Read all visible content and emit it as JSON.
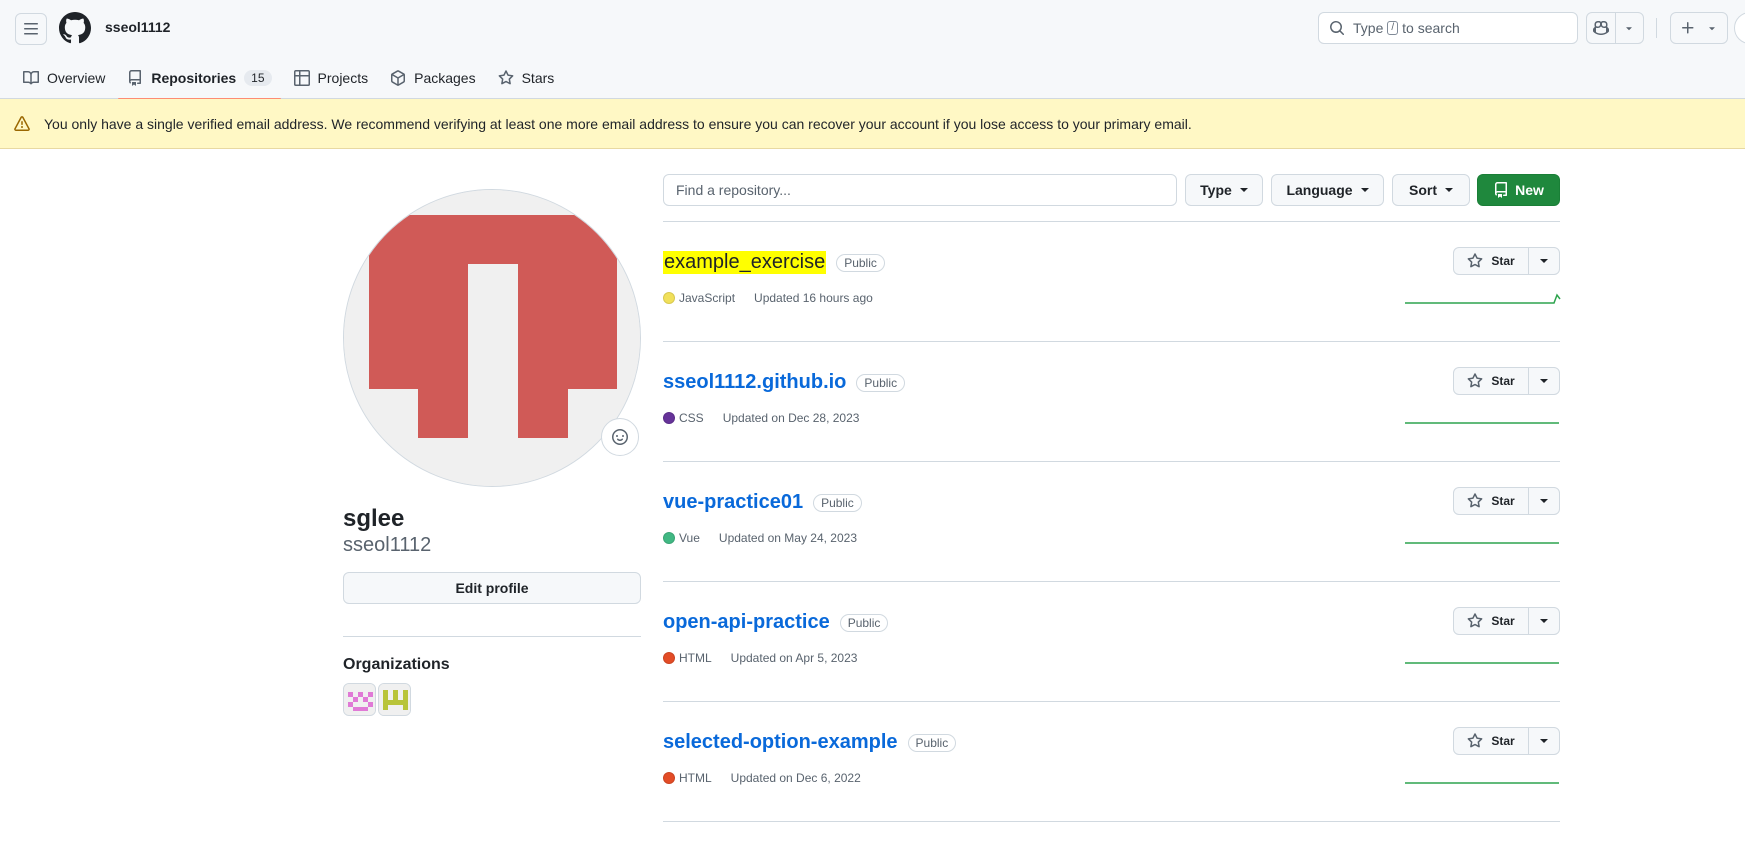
{
  "header": {
    "username": "sseol1112",
    "search": {
      "before": "Type",
      "key": "/",
      "after": "to search"
    }
  },
  "tabs": [
    {
      "label": "Overview",
      "icon": "book-icon"
    },
    {
      "label": "Repositories",
      "icon": "repo-icon",
      "count": "15",
      "active": true
    },
    {
      "label": "Projects",
      "icon": "table-icon"
    },
    {
      "label": "Packages",
      "icon": "package-icon"
    },
    {
      "label": "Stars",
      "icon": "star-icon"
    }
  ],
  "banner": {
    "icon": "alert-icon",
    "text": "You only have a single verified email address. We recommend verifying at least one more email address to ensure you can recover your account if you lose access to your primary email."
  },
  "profile": {
    "name": "sglee",
    "login": "sseol1112",
    "edit_label": "Edit profile",
    "orgs_title": "Organizations"
  },
  "filters": {
    "find_placeholder": "Find a repository...",
    "type_label": "Type",
    "language_label": "Language",
    "sort_label": "Sort",
    "new_label": "New"
  },
  "star_label": "Star",
  "repos": [
    {
      "name": "example_exercise",
      "visibility": "Public",
      "language": "JavaScript",
      "lang_color": "#f1e05a",
      "updated": "Updated 16 hours ago",
      "highlighted": true
    },
    {
      "name": "sseol1112.github.io",
      "visibility": "Public",
      "language": "CSS",
      "lang_color": "#663399",
      "updated": "Updated on Dec 28, 2023"
    },
    {
      "name": "vue-practice01",
      "visibility": "Public",
      "language": "Vue",
      "lang_color": "#41b883",
      "updated": "Updated on May 24, 2023"
    },
    {
      "name": "open-api-practice",
      "visibility": "Public",
      "language": "HTML",
      "lang_color": "#e34c26",
      "updated": "Updated on Apr 5, 2023"
    },
    {
      "name": "selected-option-example",
      "visibility": "Public",
      "language": "HTML",
      "lang_color": "#e34c26",
      "updated": "Updated on Dec 6, 2022"
    }
  ],
  "colors": {
    "accent_tab": "#fd8c73",
    "link": "#0969da",
    "new_button": "#1f883d",
    "banner_bg": "#fff8c5",
    "sparkline": "#2da44e",
    "avatar": "#d05a57"
  }
}
